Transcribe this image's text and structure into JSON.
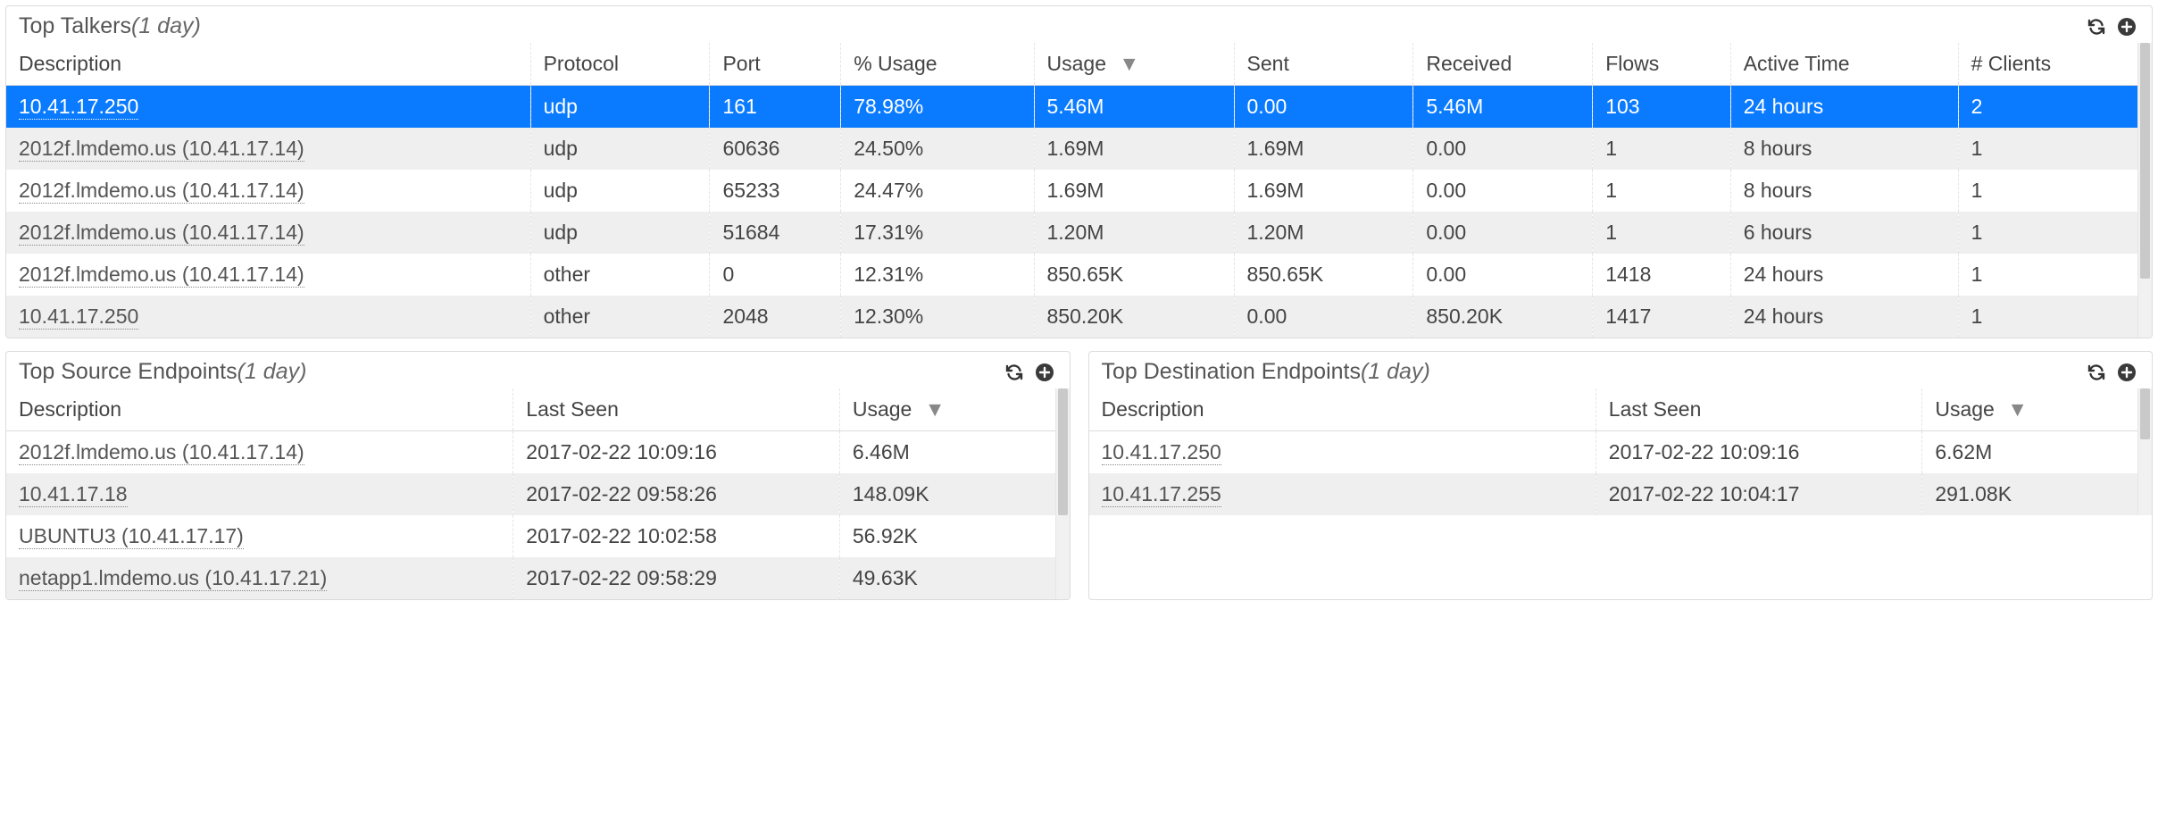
{
  "topTalkers": {
    "title": "Top Talkers",
    "range": "(1 day)",
    "headers": {
      "description": "Description",
      "protocol": "Protocol",
      "port": "Port",
      "pctUsage": "% Usage",
      "usage": "Usage",
      "sent": "Sent",
      "received": "Received",
      "flows": "Flows",
      "activeTime": "Active Time",
      "clients": "# Clients"
    },
    "rows": [
      {
        "description": "10.41.17.250",
        "protocol": "udp",
        "port": "161",
        "pctUsage": "78.98%",
        "usage": "5.46M",
        "sent": "0.00",
        "received": "5.46M",
        "flows": "103",
        "activeTime": "24 hours",
        "clients": "2",
        "selected": true
      },
      {
        "description": "2012f.lmdemo.us (10.41.17.14)",
        "protocol": "udp",
        "port": "60636",
        "pctUsage": "24.50%",
        "usage": "1.69M",
        "sent": "1.69M",
        "received": "0.00",
        "flows": "1",
        "activeTime": "8 hours",
        "clients": "1"
      },
      {
        "description": "2012f.lmdemo.us (10.41.17.14)",
        "protocol": "udp",
        "port": "65233",
        "pctUsage": "24.47%",
        "usage": "1.69M",
        "sent": "1.69M",
        "received": "0.00",
        "flows": "1",
        "activeTime": "8 hours",
        "clients": "1"
      },
      {
        "description": "2012f.lmdemo.us (10.41.17.14)",
        "protocol": "udp",
        "port": "51684",
        "pctUsage": "17.31%",
        "usage": "1.20M",
        "sent": "1.20M",
        "received": "0.00",
        "flows": "1",
        "activeTime": "6 hours",
        "clients": "1"
      },
      {
        "description": "2012f.lmdemo.us (10.41.17.14)",
        "protocol": "other",
        "port": "0",
        "pctUsage": "12.31%",
        "usage": "850.65K",
        "sent": "850.65K",
        "received": "0.00",
        "flows": "1418",
        "activeTime": "24 hours",
        "clients": "1"
      },
      {
        "description": "10.41.17.250",
        "protocol": "other",
        "port": "2048",
        "pctUsage": "12.30%",
        "usage": "850.20K",
        "sent": "0.00",
        "received": "850.20K",
        "flows": "1417",
        "activeTime": "24 hours",
        "clients": "1"
      }
    ]
  },
  "topSource": {
    "title": "Top Source Endpoints",
    "range": "(1 day)",
    "headers": {
      "description": "Description",
      "lastSeen": "Last Seen",
      "usage": "Usage"
    },
    "rows": [
      {
        "description": "2012f.lmdemo.us (10.41.17.14)",
        "lastSeen": "2017-02-22 10:09:16",
        "usage": "6.46M"
      },
      {
        "description": "10.41.17.18",
        "lastSeen": "2017-02-22 09:58:26",
        "usage": "148.09K"
      },
      {
        "description": "UBUNTU3 (10.41.17.17)",
        "lastSeen": "2017-02-22 10:02:58",
        "usage": "56.92K"
      },
      {
        "description": "netapp1.lmdemo.us (10.41.17.21)",
        "lastSeen": "2017-02-22 09:58:29",
        "usage": "49.63K"
      }
    ]
  },
  "topDest": {
    "title": "Top Destination Endpoints",
    "range": "(1 day)",
    "headers": {
      "description": "Description",
      "lastSeen": "Last Seen",
      "usage": "Usage"
    },
    "rows": [
      {
        "description": "10.41.17.250",
        "lastSeen": "2017-02-22 10:09:16",
        "usage": "6.62M"
      },
      {
        "description": "10.41.17.255",
        "lastSeen": "2017-02-22 10:04:17",
        "usage": "291.08K"
      }
    ]
  }
}
